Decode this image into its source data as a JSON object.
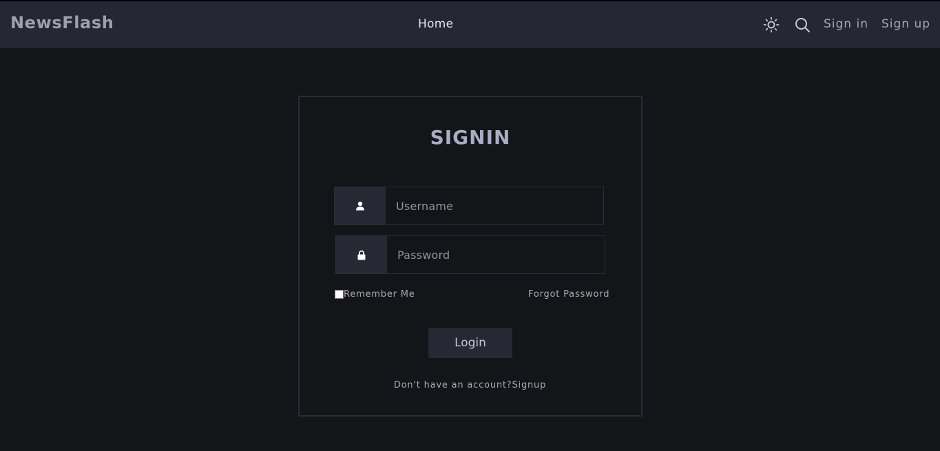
{
  "navbar": {
    "brand": "NewsFlash",
    "home_label": "Home",
    "theme_icon": "sun-icon",
    "search_icon": "search-icon",
    "signin_label": "Sign in",
    "signup_label": "Sign up"
  },
  "form": {
    "title": "SIGNIN",
    "username_icon": "user-icon",
    "username_placeholder": "Username",
    "password_icon": "lock-icon",
    "password_placeholder": "Password",
    "remember_label": "Remember Me",
    "forgot_label": "Forgot Password",
    "login_label": "Login",
    "no_account_text": "Don't have an account?",
    "signup_link": "Signup"
  },
  "colors": {
    "page_bg": "#141519",
    "navbar_bg": "#252732",
    "addon_bg": "#262833",
    "title": "#a7adc4"
  }
}
